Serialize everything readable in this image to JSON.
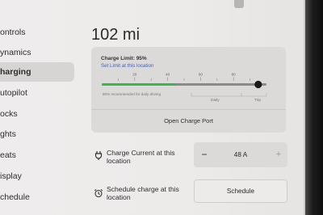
{
  "sidebar": {
    "items": [
      {
        "label": "ontrols"
      },
      {
        "label": "ynamics"
      },
      {
        "label": "harging",
        "active": true
      },
      {
        "label": "utopilot"
      },
      {
        "label": "ocks"
      },
      {
        "label": "ghts"
      },
      {
        "label": "eats"
      },
      {
        "label": "isplay"
      },
      {
        "label": "chedule"
      }
    ]
  },
  "main": {
    "range": "102 mi",
    "charge_limit": {
      "title": "Charge Limit: 95%",
      "link": "Set Limit at this location",
      "limit_percent": 95,
      "battery_percent": 45,
      "ticks": [
        "20",
        "40",
        "60",
        "80"
      ],
      "note": "80% recommended for daily driving",
      "daily_label": "Daily",
      "trip_label": "Trip",
      "colors": {
        "fill": "#3cb54a",
        "track": "#8a8a8a",
        "handle": "#1a1a1a"
      }
    },
    "open_port": "Open Charge Port",
    "charge_current": {
      "label": "Charge Current at this location",
      "icon": "plug-icon",
      "minus": "−",
      "value": "48 A",
      "plus": "+"
    },
    "schedule": {
      "label": "Schedule charge at this location",
      "icon": "alarm-clock-icon",
      "button": "Schedule"
    }
  }
}
